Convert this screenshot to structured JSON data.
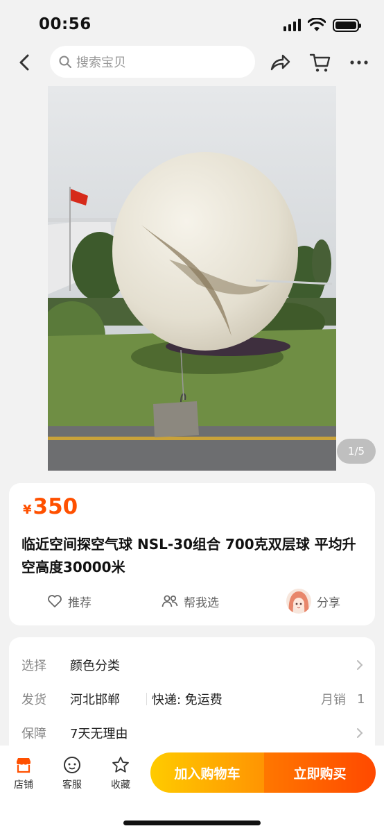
{
  "status_bar": {
    "time": "00:56"
  },
  "nav": {
    "search_placeholder": "搜索宝贝"
  },
  "gallery": {
    "counter": "1/5"
  },
  "product": {
    "currency": "¥",
    "price": "350",
    "title": "临近空间探空气球 NSL-30组合 700克双层球 平均升空高度30000米"
  },
  "actions": {
    "recommend": "推荐",
    "help_choose": "帮我选",
    "share": "分享"
  },
  "info": {
    "select_label": "选择",
    "select_value": "颜色分类",
    "ship_label": "发货",
    "ship_from": "河北邯郸",
    "express": "快递: 免运费",
    "monthly_label": "月销",
    "monthly_count": "1",
    "guarantee_label": "保障",
    "guarantee_value": "7天无理由"
  },
  "bottom_bar": {
    "shop": "店铺",
    "service": "客服",
    "favorite": "收藏",
    "add_cart": "加入购物车",
    "buy_now": "立即购买"
  },
  "colors": {
    "accent": "#ff5000",
    "cart_gradient": "#ffcb00",
    "buy_gradient": "#ff4900"
  }
}
